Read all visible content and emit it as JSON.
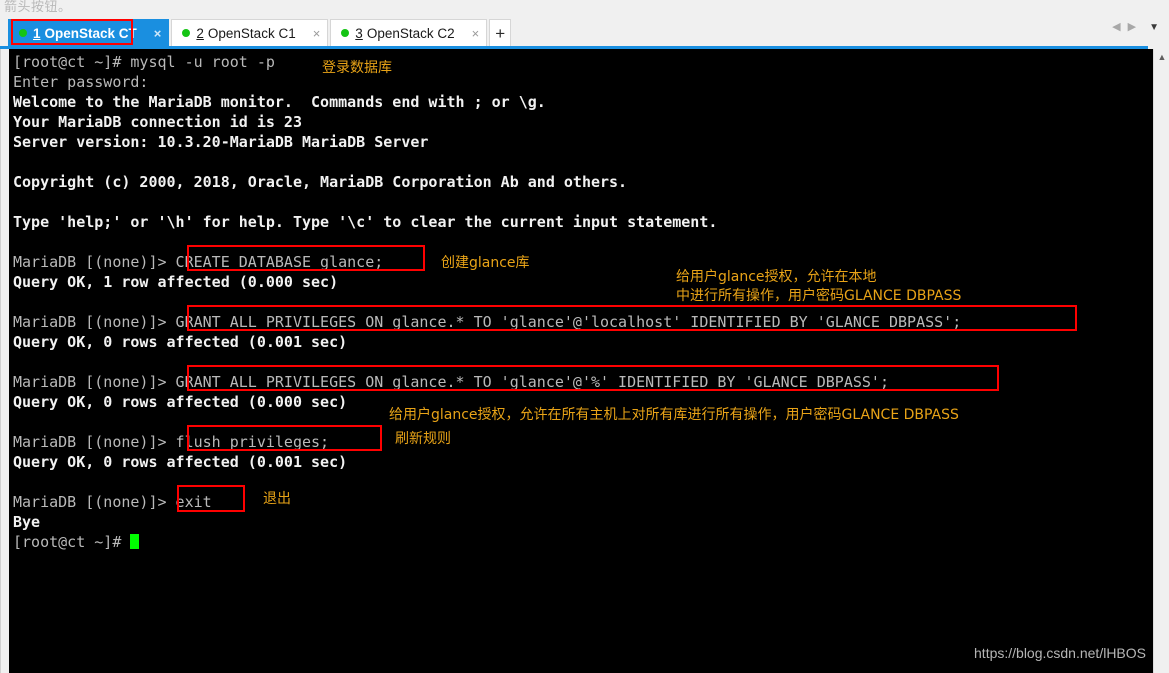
{
  "page": {
    "top_partial_text": "箭头按钮。",
    "watermark": "https://blog.csdn.net/lHBOS"
  },
  "tabbar": {
    "tabs": [
      {
        "number": "1",
        "label": "OpenStack CT",
        "active": true,
        "close_glyph": "×",
        "status_dot_color": "#14c414"
      },
      {
        "number": "2",
        "label": "OpenStack C1",
        "active": false,
        "close_glyph": "×",
        "status_dot_color": "#14c414"
      },
      {
        "number": "3",
        "label": "OpenStack C2",
        "active": false,
        "close_glyph": "×",
        "status_dot_color": "#14c414"
      }
    ],
    "add_tab_glyph": "+",
    "nav_prev_glyph": "◀",
    "nav_next_glyph": "▶",
    "nav_menu_glyph": "▼",
    "active_tab_color": "#1a8fe0",
    "highlight_color": "#ff0000"
  },
  "terminal": {
    "background": "#000000",
    "cursor_color": "#00ff00",
    "lines": [
      {
        "text": "[root@ct ~]# mysql -u root -p",
        "style": "dim"
      },
      {
        "text": "Enter password:",
        "style": "dim"
      },
      {
        "text": "Welcome to the MariaDB monitor.  Commands end with ; or \\g.",
        "style": "bold"
      },
      {
        "text": "Your MariaDB connection id is 23",
        "style": "bold"
      },
      {
        "text": "Server version: 10.3.20-MariaDB MariaDB Server",
        "style": "bold"
      },
      {
        "text": " ",
        "style": "blank"
      },
      {
        "text": "Copyright (c) 2000, 2018, Oracle, MariaDB Corporation Ab and others.",
        "style": "bold"
      },
      {
        "text": " ",
        "style": "blank"
      },
      {
        "text": "Type 'help;' or '\\h' for help. Type '\\c' to clear the current input statement.",
        "style": "bold"
      },
      {
        "text": " ",
        "style": "blank"
      },
      {
        "text": "MariaDB [(none)]> CREATE DATABASE glance;",
        "style": "dim"
      },
      {
        "text": "Query OK, 1 row affected (0.000 sec)",
        "style": "bold"
      },
      {
        "text": " ",
        "style": "blank"
      },
      {
        "text": "MariaDB [(none)]> GRANT ALL PRIVILEGES ON glance.* TO 'glance'@'localhost' IDENTIFIED BY 'GLANCE_DBPASS';",
        "style": "dim"
      },
      {
        "text": "Query OK, 0 rows affected (0.001 sec)",
        "style": "bold"
      },
      {
        "text": " ",
        "style": "blank"
      },
      {
        "text": "MariaDB [(none)]> GRANT ALL PRIVILEGES ON glance.* TO 'glance'@'%' IDENTIFIED BY 'GLANCE_DBPASS';",
        "style": "dim"
      },
      {
        "text": "Query OK, 0 rows affected (0.000 sec)",
        "style": "bold"
      },
      {
        "text": " ",
        "style": "blank"
      },
      {
        "text": "MariaDB [(none)]> flush privileges;",
        "style": "dim"
      },
      {
        "text": "Query OK, 0 rows affected (0.001 sec)",
        "style": "bold"
      },
      {
        "text": " ",
        "style": "blank"
      },
      {
        "text": "MariaDB [(none)]> exit",
        "style": "dim"
      },
      {
        "text": "Bye",
        "style": "bold"
      },
      {
        "text": "[root@ct ~]# ",
        "style": "dim",
        "cursor": true
      }
    ]
  },
  "annotations": [
    {
      "id": "login-db",
      "text": "登录数据库"
    },
    {
      "id": "create-glance",
      "text": "创建glance库"
    },
    {
      "id": "grant-local-1",
      "text": "给用户glance授权，允许在本地"
    },
    {
      "id": "grant-local-2",
      "text": "中进行所有操作，用户密码GLANCE DBPASS"
    },
    {
      "id": "grant-all-hosts",
      "text": "给用户glance授权，允许在所有主机上对所有库进行所有操作，用户密码GLANCE DBPASS"
    },
    {
      "id": "flush-rules",
      "text": "刷新规则"
    },
    {
      "id": "exit-label",
      "text": "退出"
    }
  ],
  "callout_boxes": [
    {
      "id": "box-create-database",
      "target": "CREATE DATABASE glance;"
    },
    {
      "id": "box-grant-localhost",
      "target": "GRANT ALL PRIVILEGES ON glance.* TO 'glance'@'localhost' IDENTIFIED BY 'GLANCE_DBPASS';"
    },
    {
      "id": "box-grant-wildcard",
      "target": "GRANT ALL PRIVILEGES ON glance.* TO 'glance'@'%' IDENTIFIED BY 'GLANCE_DBPASS';"
    },
    {
      "id": "box-flush-privileges",
      "target": "flush privileges;"
    },
    {
      "id": "box-exit",
      "target": "exit"
    },
    {
      "id": "box-active-tab",
      "target": "1 OpenStack CT"
    }
  ]
}
